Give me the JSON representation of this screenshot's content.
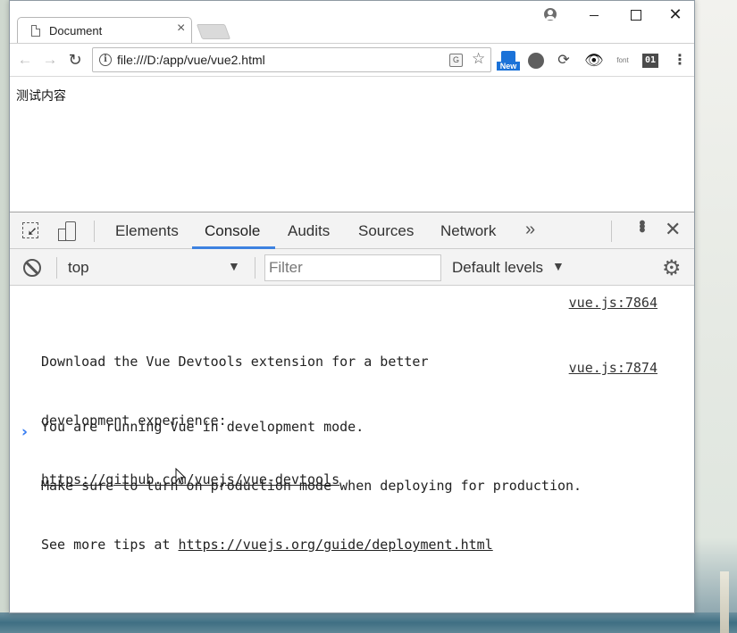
{
  "browser": {
    "tab_title": "Document",
    "url": "file:///D:/app/vue/vue2.html",
    "extensions": {
      "new_badge": "New",
      "font_label": "font",
      "counter_label": "01"
    }
  },
  "page": {
    "content_text": "测试内容"
  },
  "devtools": {
    "tabs": [
      "Elements",
      "Console",
      "Audits",
      "Sources",
      "Network"
    ],
    "active_tab": "Console",
    "more_tabs_glyph": "»",
    "context": "top",
    "filter_placeholder": "Filter",
    "levels": "Default levels",
    "messages": [
      {
        "lines": [
          "Download the Vue Devtools extension for a better",
          "development experience:"
        ],
        "link": "https://github.com/vuejs/vue-devtools",
        "source": "vue.js:7864"
      },
      {
        "lines": [
          "You are running Vue in development mode.",
          "Make sure to turn on production mode when deploying for production.",
          "See more tips at "
        ],
        "link": "https://vuejs.org/guide/deployment.html",
        "source": "vue.js:7874"
      }
    ],
    "prompt_glyph": "›"
  },
  "colors": {
    "accent": "#3d82e0",
    "prompt": "#367cf1",
    "extension_blue": "#1b72d8"
  }
}
